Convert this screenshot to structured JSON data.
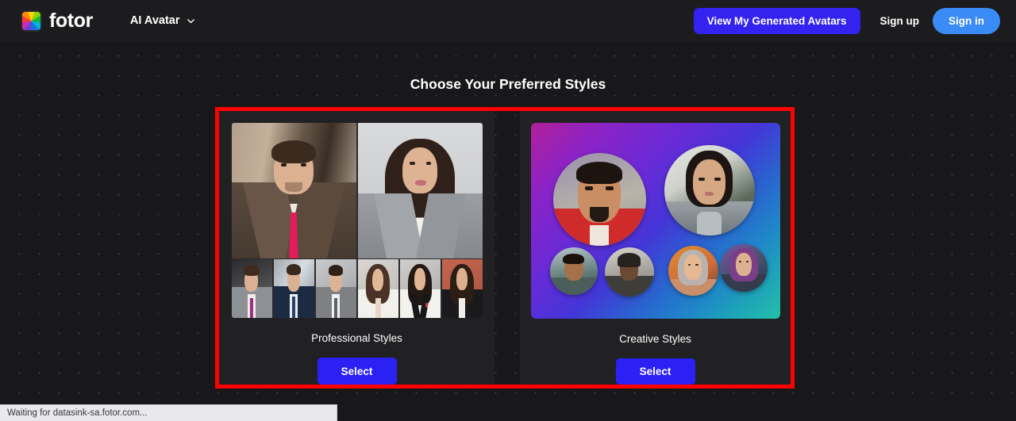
{
  "header": {
    "logo_text": "fotor",
    "logo_icon": "fotor-rainbow-logo-icon",
    "nav_item": "AI Avatar",
    "nav_chevron_icon": "chevron-down-icon",
    "generated_avatars_button": "View My Generated Avatars",
    "sign_up_link": "Sign up",
    "sign_in_button": "Sign in",
    "colors": {
      "bar_bg": "#1c1c1e",
      "generated_button_bg": "#3322f0",
      "sign_in_button_bg": "#3a8bf5"
    }
  },
  "main": {
    "title": "Choose Your Preferred Styles",
    "highlight_box_color": "#fe0000",
    "cards": [
      {
        "id": "professional",
        "label": "Professional Styles",
        "select_label": "Select",
        "preview_alt": "grid of professional business headshot portraits",
        "thumbnail_count": 6
      },
      {
        "id": "creative",
        "label": "Creative Styles",
        "select_label": "Select",
        "preview_alt": "gradient panel with circular stylized avatar portraits",
        "avatar_count": 6
      }
    ],
    "select_button_color": "#2b21f5",
    "card_bg": "#212124",
    "page_bg": "#18181a"
  },
  "status_bar": {
    "text": "Waiting for datasink-sa.fotor.com..."
  }
}
